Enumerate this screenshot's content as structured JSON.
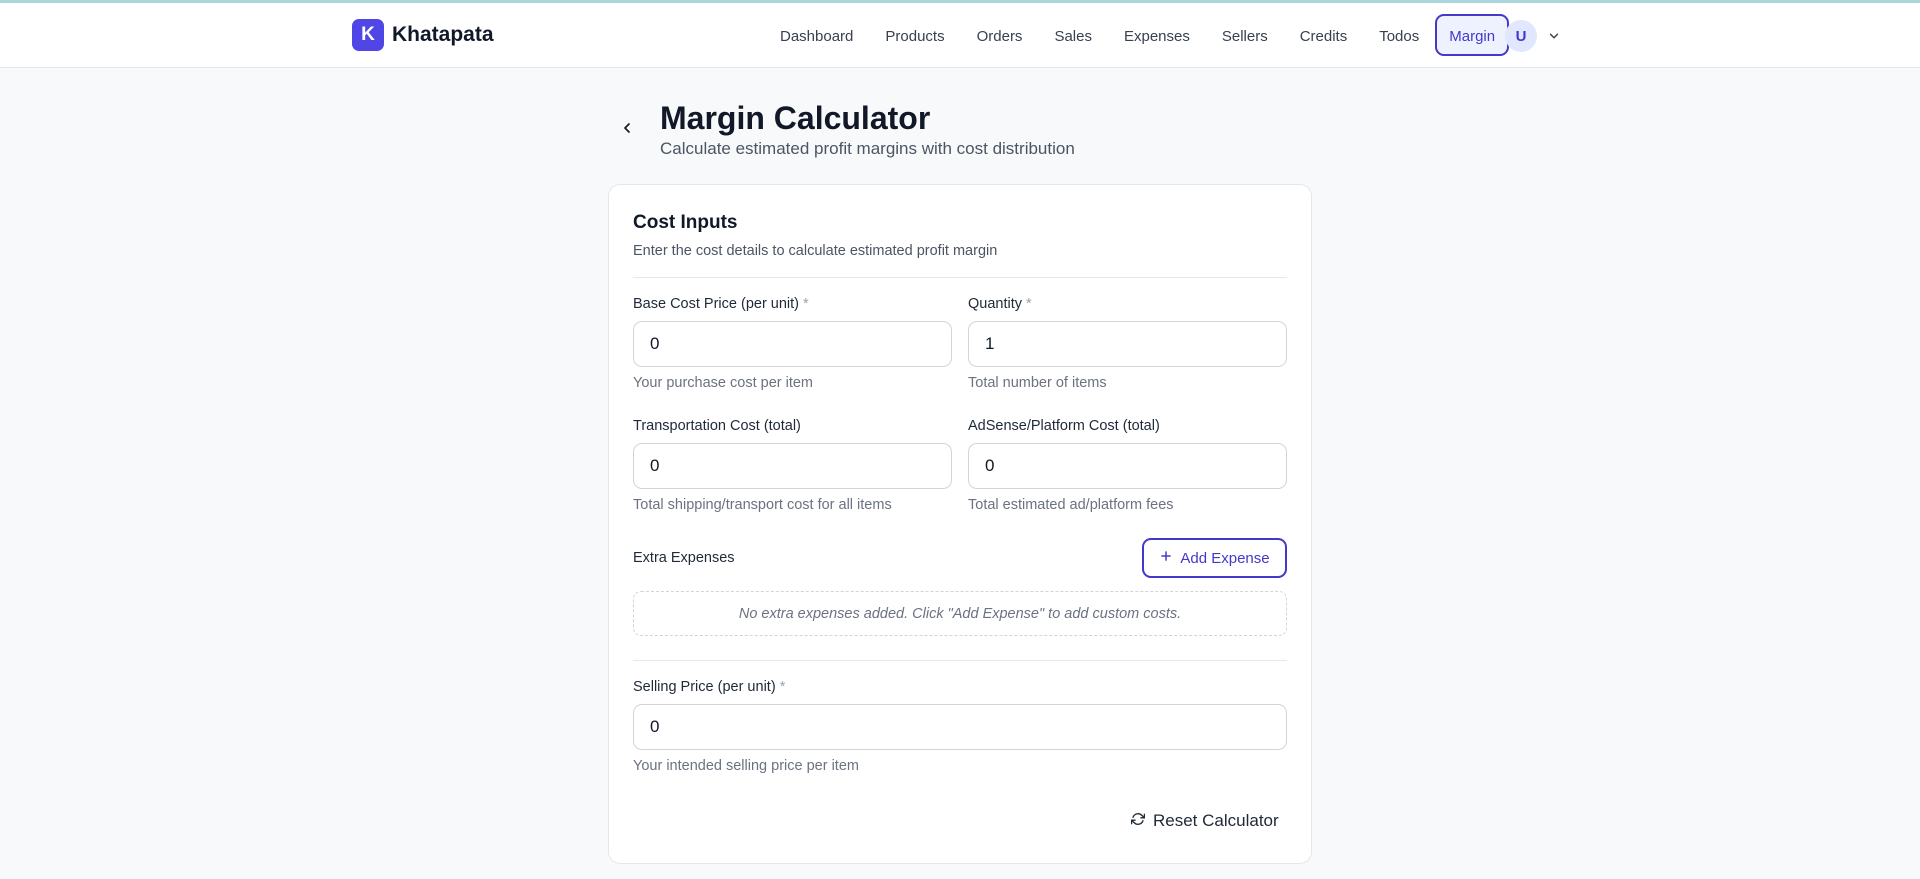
{
  "brand": {
    "logo_letter": "K",
    "name": "Khatapata"
  },
  "nav": {
    "items": [
      {
        "label": "Dashboard"
      },
      {
        "label": "Products"
      },
      {
        "label": "Orders"
      },
      {
        "label": "Sales"
      },
      {
        "label": "Expenses"
      },
      {
        "label": "Sellers"
      },
      {
        "label": "Credits"
      },
      {
        "label": "Todos"
      },
      {
        "label": "Margin",
        "active": true
      }
    ]
  },
  "user": {
    "initial": "U"
  },
  "page": {
    "title": "Margin Calculator",
    "subtitle": "Calculate estimated profit margins with cost distribution"
  },
  "card": {
    "title": "Cost Inputs",
    "description": "Enter the cost details to calculate estimated profit margin",
    "fields": {
      "base_cost": {
        "label": "Base Cost Price (per unit)",
        "required_mark": "*",
        "value": "0",
        "hint": "Your purchase cost per item"
      },
      "quantity": {
        "label": "Quantity",
        "required_mark": "*",
        "value": "1",
        "hint": "Total number of items"
      },
      "transport": {
        "label": "Transportation Cost (total)",
        "value": "0",
        "hint": "Total shipping/transport cost for all items"
      },
      "adsense": {
        "label": "AdSense/Platform Cost (total)",
        "value": "0",
        "hint": "Total estimated ad/platform fees"
      },
      "selling_price": {
        "label": "Selling Price (per unit)",
        "required_mark": "*",
        "value": "0",
        "hint": "Your intended selling price per item"
      }
    },
    "extra_expenses": {
      "label": "Extra Expenses",
      "add_button_label": "Add Expense",
      "empty_text": "No extra expenses added. Click \"Add Expense\" to add custom costs."
    },
    "reset_button_label": "Reset Calculator"
  },
  "colors": {
    "accent": "#4338ca",
    "logo_bg": "#4f46e5",
    "page_bg": "#f8f9fb",
    "top_line": "#a9d6da"
  },
  "icons": {
    "back": "chevron-left-icon",
    "user_menu": "chevron-down-icon",
    "add": "plus-icon",
    "reset": "refresh-icon"
  }
}
